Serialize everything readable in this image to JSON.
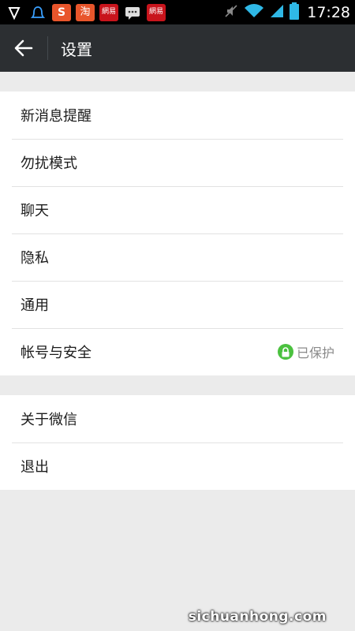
{
  "status_bar": {
    "apps": [
      {
        "name": "shield-icon",
        "label": "",
        "color": "#000000"
      },
      {
        "name": "qq-icon",
        "label": "",
        "color": "#000000"
      },
      {
        "name": "s-app-icon",
        "label": "S",
        "color": "#e8552b"
      },
      {
        "name": "taobao-icon",
        "label": "淘",
        "color": "#e8552b"
      },
      {
        "name": "netease-icon",
        "label": "網易",
        "color": "#c8141c"
      },
      {
        "name": "message-icon",
        "label": "",
        "color": "#000000"
      },
      {
        "name": "netease-icon-2",
        "label": "網易",
        "color": "#c8141c"
      }
    ],
    "time": "17:28"
  },
  "header": {
    "title": "设置"
  },
  "group1": [
    {
      "label": "新消息提醒"
    },
    {
      "label": "勿扰模式"
    },
    {
      "label": "聊天"
    },
    {
      "label": "隐私"
    },
    {
      "label": "通用"
    },
    {
      "label": "帐号与安全",
      "badge": "已保护"
    }
  ],
  "group2": [
    {
      "label": "关于微信"
    },
    {
      "label": "退出"
    }
  ],
  "watermark": "sichuanhong.com",
  "colors": {
    "header_bg": "#2c2f32",
    "protected_green": "#4bc13f",
    "page_bg": "#ebebeb"
  }
}
